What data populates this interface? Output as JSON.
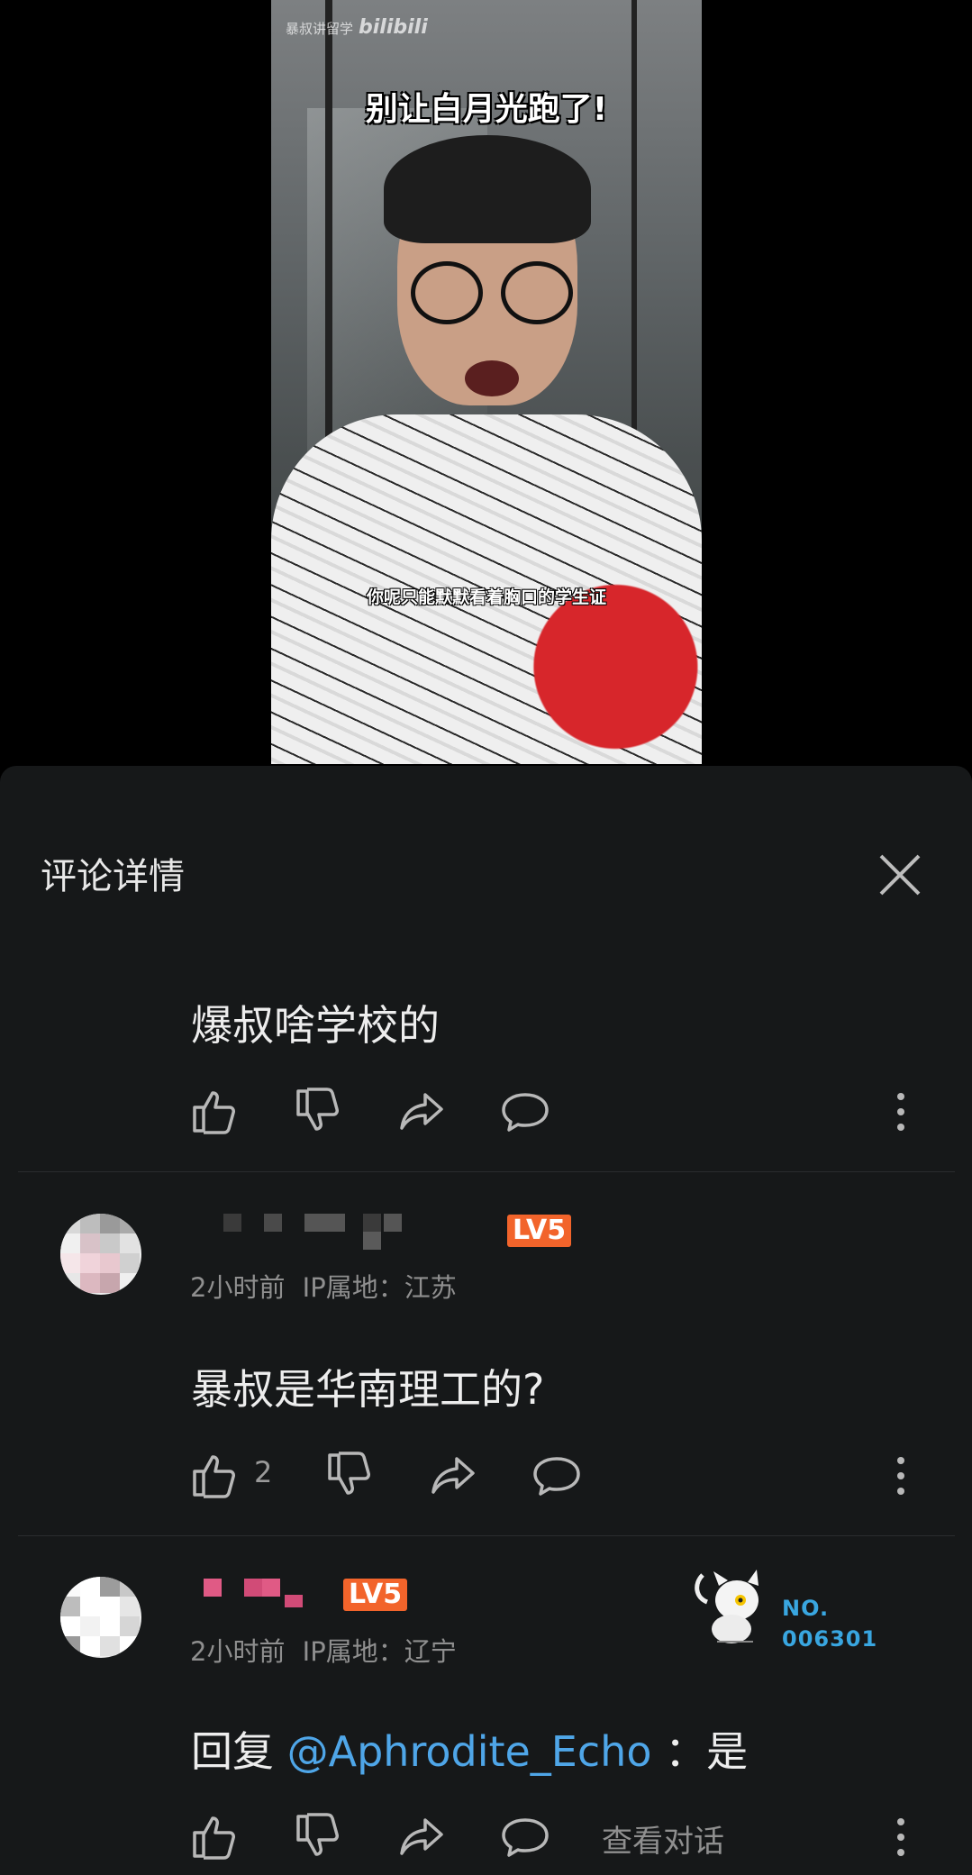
{
  "video": {
    "watermark_channel": "暴叔讲留学",
    "watermark_brand": "bilibili",
    "title_caption": "别让白月光跑了!",
    "subtitle_caption": "你呢只能默默看着胸口的学生证"
  },
  "sheet": {
    "title": "评论详情",
    "close_icon": "close-icon"
  },
  "comments": [
    {
      "text": "爆叔啥学校的",
      "like_count": "",
      "icons": [
        "thumbs-up-icon",
        "thumbs-down-icon",
        "share-icon",
        "reply-icon",
        "more-icon"
      ]
    },
    {
      "level": "LV5",
      "time": "2小时前",
      "ip": "IP属地：江苏",
      "text": "暴叔是华南理工的?",
      "like_count": "2"
    },
    {
      "level": "LV5",
      "time": "2小时前",
      "ip": "IP属地：辽宁",
      "reply_prefix": "回复",
      "mention": "@Aphrodite_Echo",
      "reply_suffix": "：是",
      "view_conversation": "查看对话",
      "badge_label": "NO.",
      "badge_number": "006301"
    }
  ],
  "colors": {
    "sheet_bg": "#161819",
    "level_badge": "#f2642b",
    "mention": "#4fa6e8"
  }
}
